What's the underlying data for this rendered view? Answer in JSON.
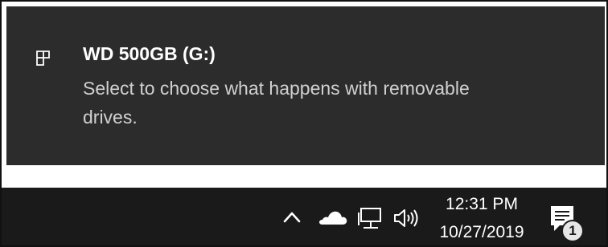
{
  "notification": {
    "icon": "removable-drive-icon",
    "title": "WD 500GB (G:)",
    "body": "Select to choose what happens with removable drives."
  },
  "taskbar": {
    "tray_icons": [
      "chevron-up-icon",
      "onedrive-cloud-icon",
      "network-icon",
      "volume-icon"
    ],
    "clock": {
      "time": "12:31 PM",
      "date": "10/27/2019"
    },
    "action_center": {
      "icon": "action-center-icon",
      "badge_count": "1"
    }
  },
  "colors": {
    "toast_background": "#2c2c2c",
    "taskbar_background": "#1a1a1a",
    "title_text": "#ffffff",
    "body_text": "#d0d0d0"
  }
}
